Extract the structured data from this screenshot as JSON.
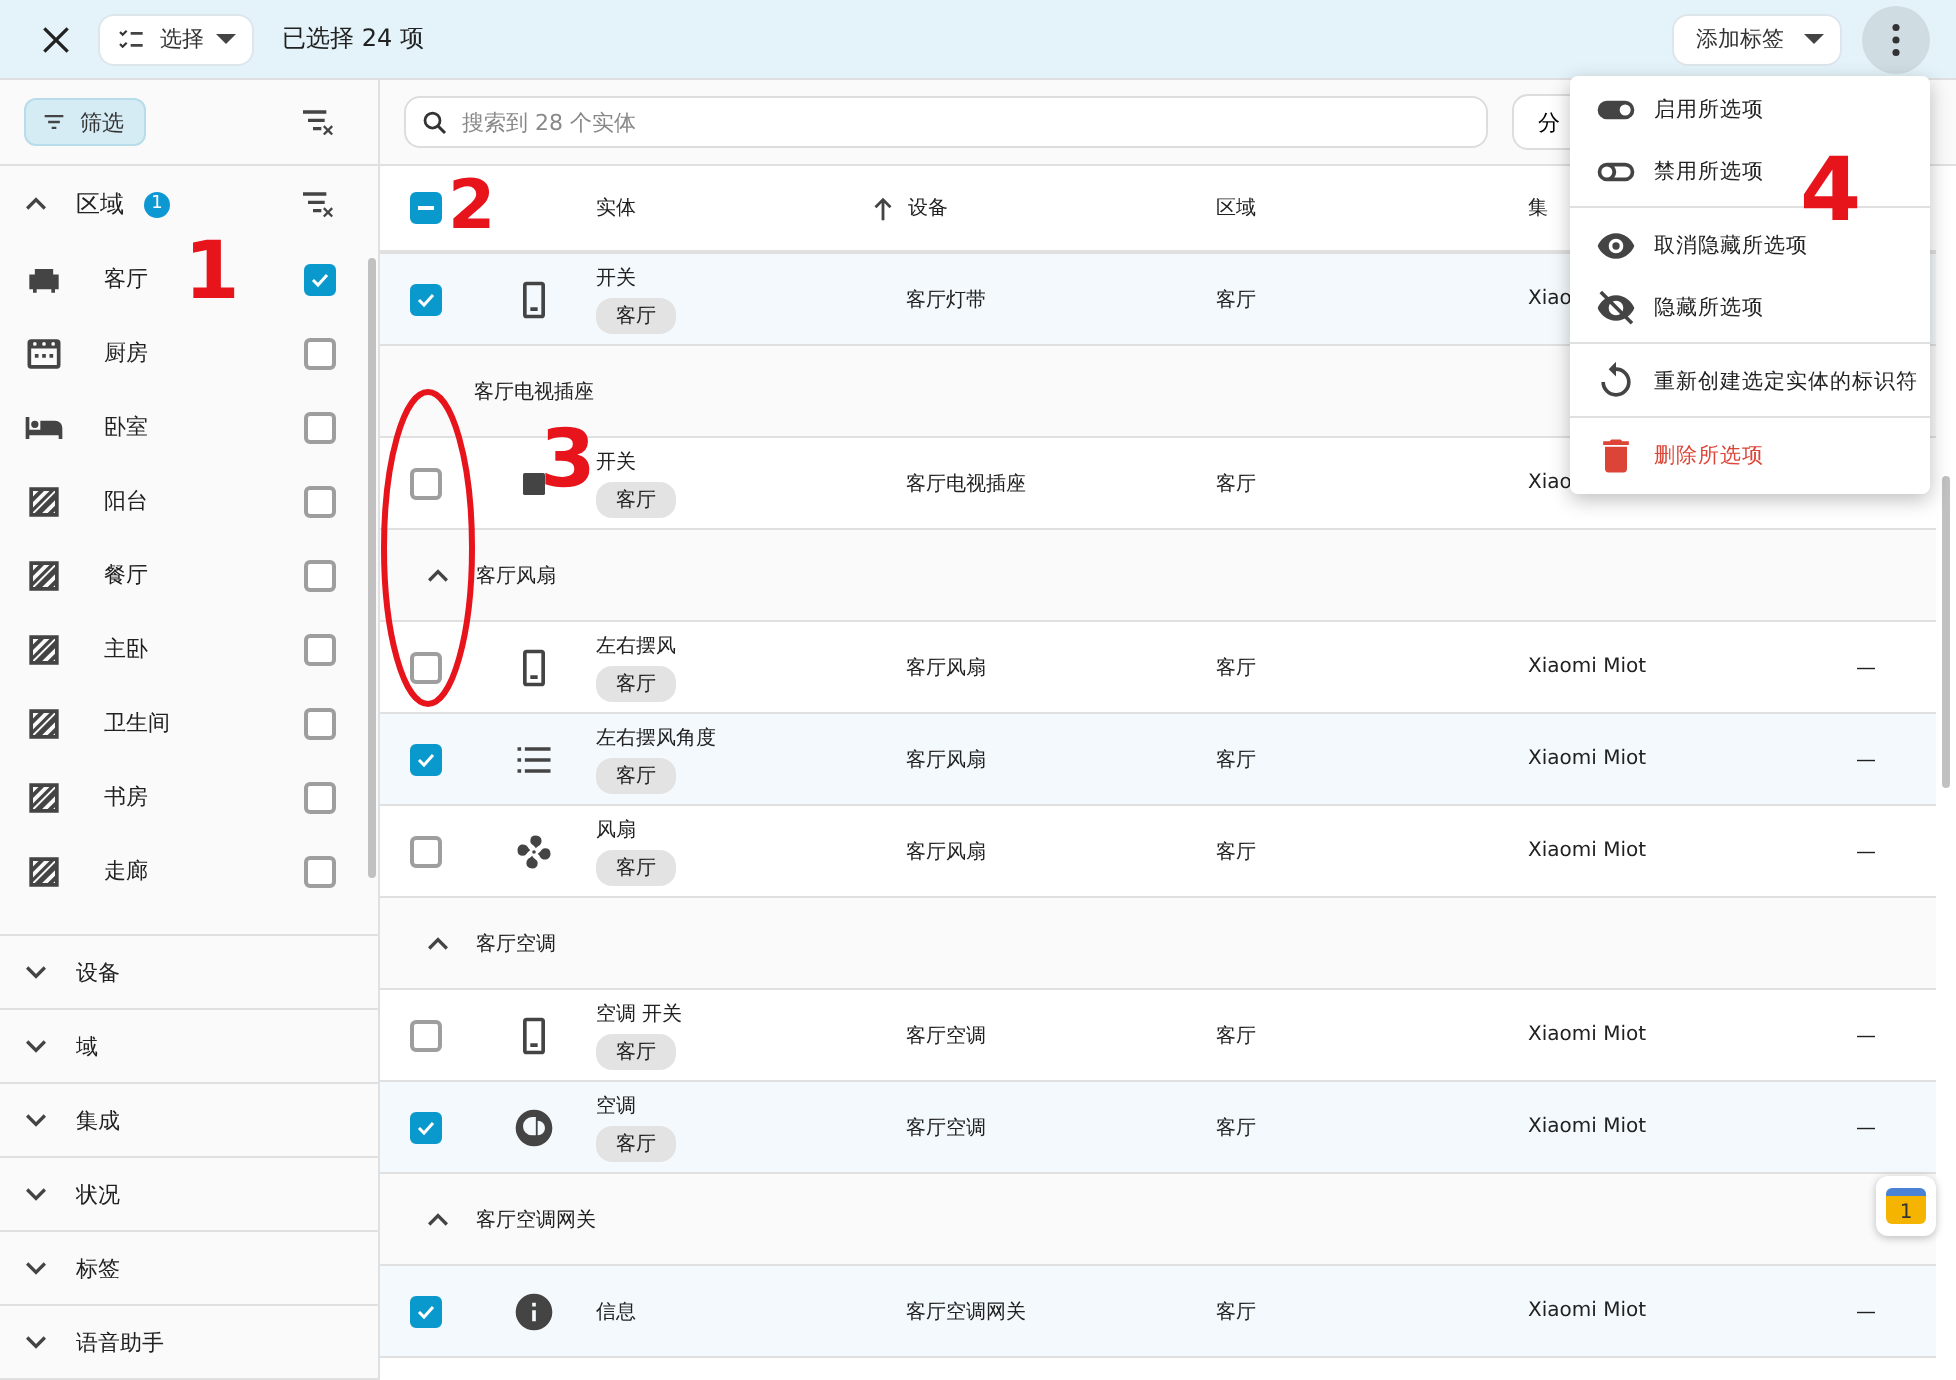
{
  "top_bar": {
    "select_button": "选择",
    "selection_count": "已选择 24 项",
    "add_label_button": "添加标签"
  },
  "sidebar": {
    "filter_button": "筛选",
    "area_section": {
      "title": "区域",
      "badge": "1",
      "expanded": true,
      "items": [
        {
          "label": "客厅",
          "checked": true
        },
        {
          "label": "厨房",
          "checked": false
        },
        {
          "label": "卧室",
          "checked": false
        },
        {
          "label": "阳台",
          "checked": false
        },
        {
          "label": "餐厅",
          "checked": false
        },
        {
          "label": "主卧",
          "checked": false
        },
        {
          "label": "卫生间",
          "checked": false
        },
        {
          "label": "书房",
          "checked": false
        },
        {
          "label": "走廊",
          "checked": false
        }
      ]
    },
    "sections": [
      {
        "title": "设备",
        "expanded": false
      },
      {
        "title": "域",
        "expanded": false
      },
      {
        "title": "集成",
        "expanded": false
      },
      {
        "title": "状况",
        "expanded": false
      },
      {
        "title": "标签",
        "expanded": false
      },
      {
        "title": "语音助手",
        "expanded": false
      }
    ]
  },
  "search": {
    "placeholder": "搜索到 28 个实体"
  },
  "group_button": "分",
  "table": {
    "select_all_indeterminate": true,
    "columns": [
      {
        "label": "实体",
        "sorted": false
      },
      {
        "label": "设备",
        "sorted": true
      },
      {
        "label": "区域",
        "sorted": false
      },
      {
        "label": "集",
        "sorted": false
      }
    ],
    "rows": [
      {
        "kind": "entity",
        "selected": true,
        "name": "开关",
        "chip": "客厅",
        "device": "客厅灯带",
        "area": "客厅",
        "integration": "Xiao"
      },
      {
        "kind": "group",
        "title": "客厅电视插座"
      },
      {
        "kind": "entity",
        "selected": false,
        "name": "开关",
        "chip": "客厅",
        "device": "客厅电视插座",
        "area": "客厅",
        "integration": "Xiao"
      },
      {
        "kind": "group",
        "title": "客厅风扇",
        "expanded": true
      },
      {
        "kind": "entity",
        "selected": false,
        "name": "左右摆风",
        "chip": "客厅",
        "device": "客厅风扇",
        "area": "客厅",
        "integration": "Xiaomi Miot",
        "extra": "—"
      },
      {
        "kind": "entity",
        "selected": true,
        "name": "左右摆风角度",
        "chip": "客厅",
        "device": "客厅风扇",
        "area": "客厅",
        "integration": "Xiaomi Miot",
        "extra": "—"
      },
      {
        "kind": "entity",
        "selected": false,
        "name": "风扇",
        "chip": "客厅",
        "device": "客厅风扇",
        "area": "客厅",
        "integration": "Xiaomi Miot",
        "extra": "—"
      },
      {
        "kind": "group",
        "title": "客厅空调",
        "expanded": true
      },
      {
        "kind": "entity",
        "selected": false,
        "name": "空调 开关",
        "chip": "客厅",
        "device": "客厅空调",
        "area": "客厅",
        "integration": "Xiaomi Miot",
        "extra": "—"
      },
      {
        "kind": "entity",
        "selected": true,
        "name": "空调",
        "chip": "客厅",
        "device": "客厅空调",
        "area": "客厅",
        "integration": "Xiaomi Miot",
        "extra": "—"
      },
      {
        "kind": "group",
        "title": "客厅空调网关",
        "expanded": true
      },
      {
        "kind": "entity",
        "selected": true,
        "name": "信息",
        "device": "客厅空调网关",
        "area": "客厅",
        "integration": "Xiaomi Miot",
        "extra": "—"
      }
    ]
  },
  "menu": {
    "items": [
      {
        "label": "启用所选项",
        "kind": "normal"
      },
      {
        "label": "禁用所选项",
        "kind": "normal"
      },
      {
        "label": "取消隐藏所选项",
        "kind": "normal",
        "divider_before": true
      },
      {
        "label": "隐藏所选项",
        "kind": "normal"
      },
      {
        "label": "重新创建选定实体的标识符",
        "kind": "normal",
        "divider_before": true
      },
      {
        "label": "删除所选项",
        "kind": "danger",
        "divider_before": true
      }
    ]
  },
  "floating_badge": "1",
  "annotations": [
    {
      "kind": "digit",
      "label": "1"
    },
    {
      "kind": "digit",
      "label": "2"
    },
    {
      "kind": "digit",
      "label": "3"
    },
    {
      "kind": "digit",
      "label": "4"
    },
    {
      "kind": "circle"
    }
  ]
}
